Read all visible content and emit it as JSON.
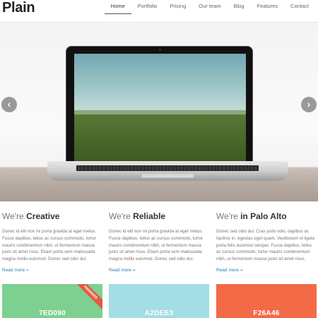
{
  "header": {
    "logo": "Plain",
    "nav": [
      {
        "label": "Home",
        "active": true
      },
      {
        "label": "Portfolio",
        "active": false
      },
      {
        "label": "Pricing",
        "active": false
      },
      {
        "label": "Our team",
        "active": false
      },
      {
        "label": "Blog",
        "active": false
      },
      {
        "label": "Features",
        "active": false
      },
      {
        "label": "Contact",
        "active": false
      }
    ]
  },
  "hero": {
    "prev_symbol": "‹",
    "next_symbol": "›",
    "prev_icon": "chevron-left-icon",
    "next_icon": "chevron-right-icon"
  },
  "columns": [
    {
      "prefix": "We're ",
      "title": "Creative",
      "text": "Donec id elit non mi porta gravida at eget metus. Fusce dapibus, tellus ac cursus commodo, tortor mauris condimentum nibh, ut fermentum massa justo sit amet risus. Etiam porta sem malesuada magna mollis euismod. Donec sed odio dui.",
      "link": "Read more »"
    },
    {
      "prefix": "We're ",
      "title": "Reliable",
      "text": "Donec id elit non mi porta gravida at eget metus. Fusce dapibus, tellus ac cursus commodo, tortor mauris condimentum nibh, ut fermentum massa justo sit amet risus. Etiam porta sem malesuada magna mollis euismod. Donec sed odio dui.",
      "link": "Read more »"
    },
    {
      "prefix": "We're ",
      "title": "in Palo Alto",
      "text": "Donec sed odio dui. Cras justo odio, dapibus ac facilisis in, egestas eget quam. Vestibulum id ligula porta felis euismod semper. Fusce dapibus, tellus ac cursus commodo, tortor mauris condimentum nibh, ut fermentum massa justo sit amet risus.",
      "link": "Read more »"
    }
  ],
  "boxes": [
    {
      "code": "7ED090",
      "color": "#7ED090",
      "ribbon": "AWARDED"
    },
    {
      "code": "A2DEE3",
      "color": "#A2DEE3",
      "ribbon": ""
    },
    {
      "code": "F26A46",
      "color": "#F26A46",
      "ribbon": ""
    }
  ]
}
